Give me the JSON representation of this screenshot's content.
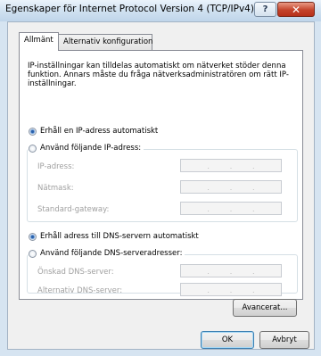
{
  "window": {
    "title": "Egenskaper för Internet Protocol Version 4 (TCP/IPv4)",
    "help_label": "?"
  },
  "tabs": [
    {
      "label": "Allmänt",
      "active": true
    },
    {
      "label": "Alternativ konfiguration",
      "active": false
    }
  ],
  "description": "IP-inställningar kan tilldelas automatiskt om nätverket stöder denna funktion. Annars måste du fråga nätverksadministratören om rätt IP-inställningar.",
  "ip": {
    "auto_label": "Erhåll en IP-adress automatiskt",
    "auto_selected": true,
    "manual_label": "Använd följande IP-adress:",
    "fields": [
      {
        "label": "IP-adress:",
        "value": ""
      },
      {
        "label": "Nätmask:",
        "value": ""
      },
      {
        "label": "Standard-gateway:",
        "value": ""
      }
    ]
  },
  "dns": {
    "auto_label": "Erhåll adress till DNS-servern automatiskt",
    "auto_selected": true,
    "manual_label": "Använd följande DNS-serveradresser:",
    "fields": [
      {
        "label": "Önskad DNS-server:",
        "value": ""
      },
      {
        "label": "Alternativ DNS-server:",
        "value": ""
      }
    ]
  },
  "buttons": {
    "advanced": "Avancerat...",
    "ok": "OK",
    "cancel": "Avbryt"
  },
  "ip_dot": "."
}
